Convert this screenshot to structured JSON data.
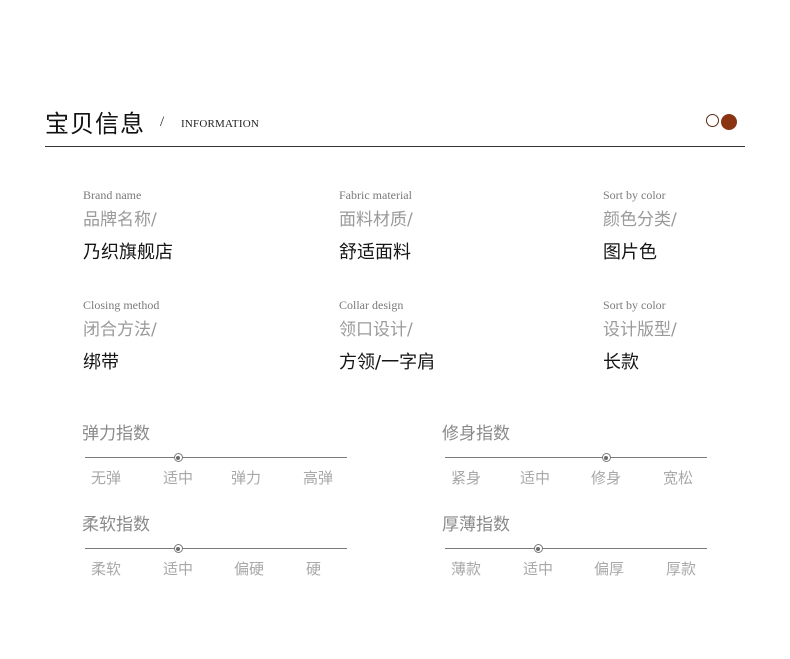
{
  "header": {
    "title_cn": "宝贝信息",
    "slash": "/",
    "title_en": "INFORMATION",
    "accent_color": "#8b3412"
  },
  "info": [
    {
      "en": "Brand name",
      "cn": "品牌名称/",
      "value": "乃织旗舰店"
    },
    {
      "en": "Fabric material",
      "cn": "面料材质/",
      "value": "舒适面料"
    },
    {
      "en": "Sort by color",
      "cn": "颜色分类/",
      "value": "图片色"
    },
    {
      "en": "Closing method",
      "cn": "闭合方法/",
      "value": "绑带"
    },
    {
      "en": "Collar design",
      "cn": "领口设计/",
      "value": "方领/一字肩"
    },
    {
      "en": "Sort by color",
      "cn": "设计版型/",
      "value": "长款"
    }
  ],
  "scales": [
    {
      "label": "弹力指数",
      "options": [
        "无弹",
        "适中",
        "弹力",
        "高弹"
      ],
      "selected_index": 1
    },
    {
      "label": "修身指数",
      "options": [
        "紧身",
        "适中",
        "修身",
        "宽松"
      ],
      "selected_index": 2
    },
    {
      "label": "柔软指数",
      "options": [
        "柔软",
        "适中",
        "偏硬",
        "硬"
      ],
      "selected_index": 1
    },
    {
      "label": "厚薄指数",
      "options": [
        "薄款",
        "适中",
        "偏厚",
        "厚款"
      ],
      "selected_index": 1
    }
  ]
}
